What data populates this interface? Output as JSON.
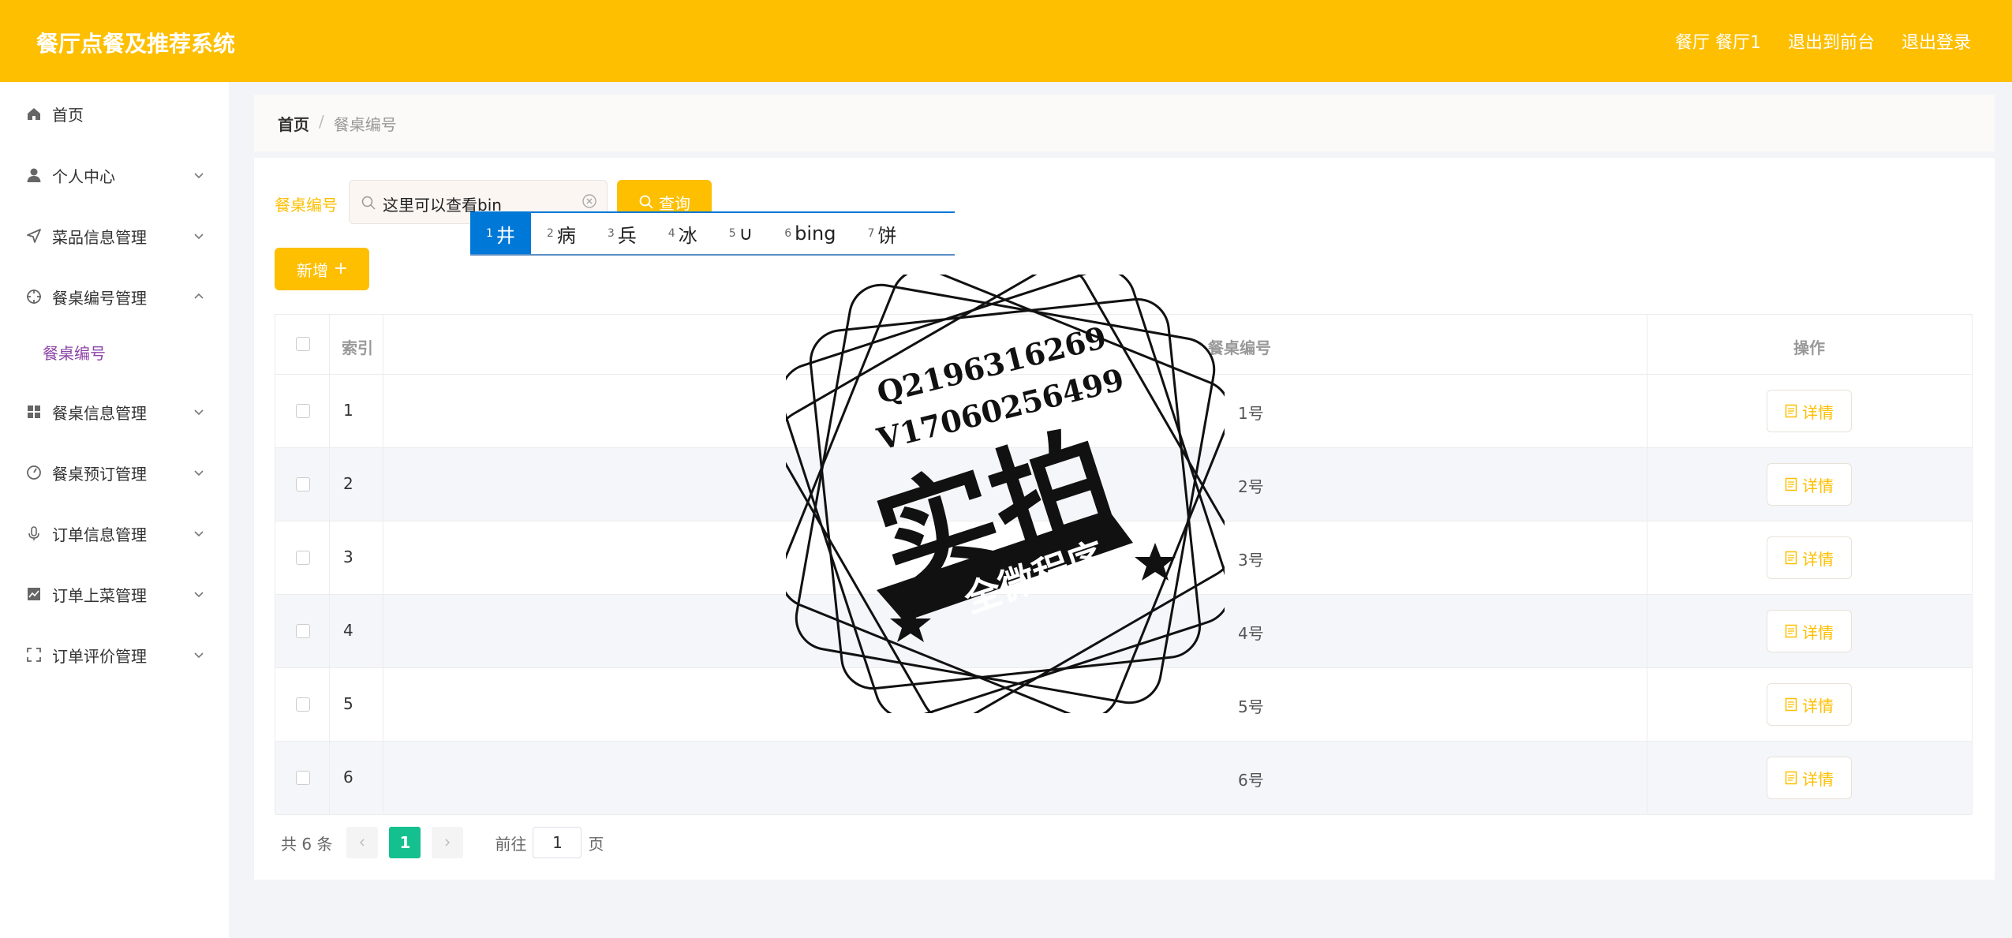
{
  "header": {
    "title": "餐厅点餐及推荐系统",
    "user": "餐厅 餐厅1",
    "to_front": "退出到前台",
    "logout": "退出登录"
  },
  "sidebar": {
    "items": [
      {
        "label": "首页",
        "icon": "home-icon"
      },
      {
        "label": "个人中心",
        "icon": "user-icon"
      },
      {
        "label": "菜品信息管理",
        "icon": "send-icon"
      },
      {
        "label": "餐桌编号管理",
        "icon": "target-icon"
      },
      {
        "label": "餐桌信息管理",
        "icon": "grid-icon"
      },
      {
        "label": "餐桌预订管理",
        "icon": "gauge-icon"
      },
      {
        "label": "订单信息管理",
        "icon": "microphone-icon"
      },
      {
        "label": "订单上菜管理",
        "icon": "chart-icon"
      },
      {
        "label": "订单评价管理",
        "icon": "fullscreen-icon"
      }
    ],
    "submenu": "餐桌编号"
  },
  "breadcrumb": {
    "home": "首页",
    "sep": "/",
    "current": "餐桌编号"
  },
  "search": {
    "label": "餐桌编号",
    "value": "这里可以查看bin",
    "query_label": "查询"
  },
  "ime": {
    "candidates": [
      {
        "num": "1",
        "text": "井"
      },
      {
        "num": "2",
        "text": "病"
      },
      {
        "num": "3",
        "text": "兵"
      },
      {
        "num": "4",
        "text": "冰"
      },
      {
        "num": "5",
        "text": "∪"
      },
      {
        "num": "6",
        "text": "bing"
      },
      {
        "num": "7",
        "text": "饼"
      }
    ]
  },
  "add_label": "新增",
  "table": {
    "headers": {
      "index": "索引",
      "name": "餐桌编号",
      "action": "操作"
    },
    "detail_label": "详情",
    "rows": [
      {
        "index": "1",
        "name": "1号"
      },
      {
        "index": "2",
        "name": "2号"
      },
      {
        "index": "3",
        "name": "3号"
      },
      {
        "index": "4",
        "name": "4号"
      },
      {
        "index": "5",
        "name": "5号"
      },
      {
        "index": "6",
        "name": "6号"
      }
    ]
  },
  "pager": {
    "total": "共 6 条",
    "current": "1",
    "goto": "前往",
    "goto_value": "1",
    "page_suffix": "页"
  },
  "watermark": {
    "line1": "Q2196316269",
    "line2": "V17060256499",
    "big": "实拍",
    "ribbon": "全微程序"
  },
  "colors": {
    "brand": "#fdbf00",
    "active_page": "#13c08e",
    "ime_highlight": "#0078d7",
    "submenu_active": "#8c44a8"
  }
}
